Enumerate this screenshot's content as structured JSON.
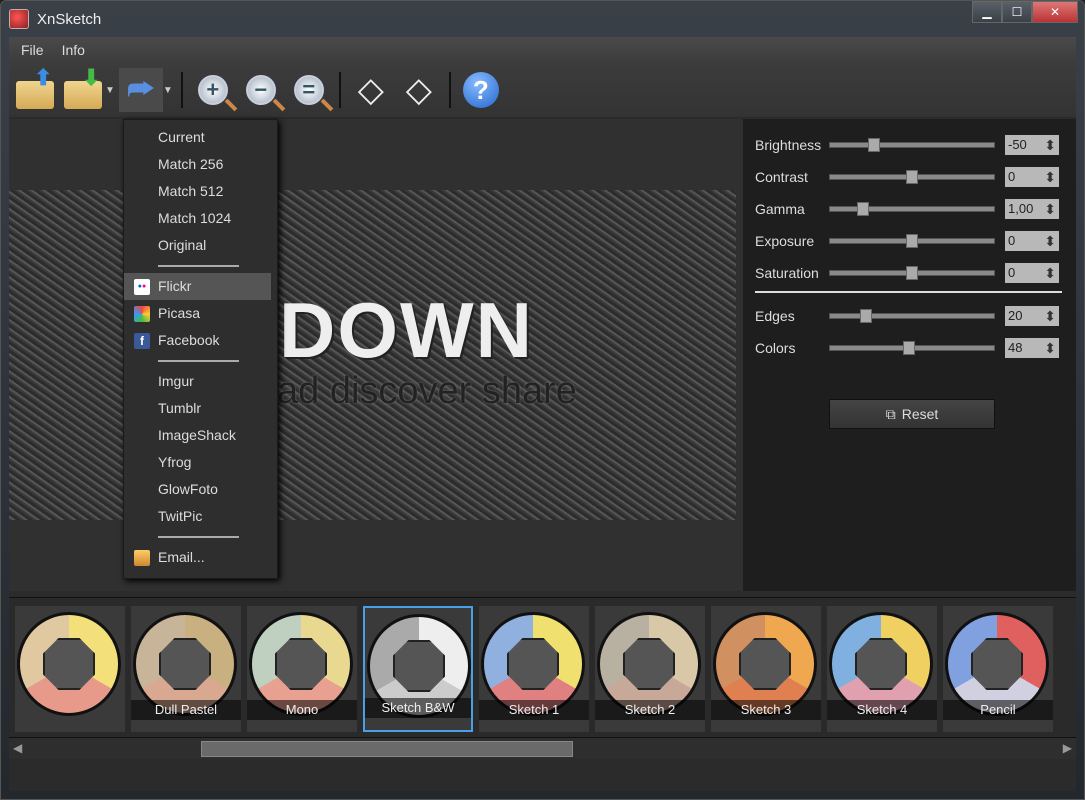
{
  "window": {
    "title": "XnSketch",
    "minimize": "▁",
    "maximize": "☐",
    "close": "✕"
  },
  "menubar": [
    "File",
    "Info"
  ],
  "toolbar": {
    "help": "?"
  },
  "preview": {
    "logo_text": "DOWN",
    "slogan": "ad discover share"
  },
  "export_menu": {
    "sizes": [
      {
        "label": "Current",
        "checked": false
      },
      {
        "label": "Match 256",
        "checked": false
      },
      {
        "label": "Match 512",
        "checked": true
      },
      {
        "label": "Match 1024",
        "checked": false
      },
      {
        "label": "Original",
        "checked": false
      }
    ],
    "check_glyph": "✔",
    "services": [
      {
        "label": "Flickr",
        "highlighted": true,
        "icon": "flickr-icon"
      },
      {
        "label": "Picasa",
        "icon": "picasa-icon"
      },
      {
        "label": "Facebook",
        "icon": "facebook-icon",
        "glyph": "f"
      }
    ],
    "others": [
      "Imgur",
      "Tumblr",
      "ImageShack",
      "Yfrog",
      "GlowFoto",
      "TwitPic"
    ],
    "email": "Email..."
  },
  "adjustments": [
    {
      "label": "Brightness",
      "value": "-50",
      "position": 0.27
    },
    {
      "label": "Contrast",
      "value": "0",
      "position": 0.5
    },
    {
      "label": "Gamma",
      "value": "1,00",
      "position": 0.2
    },
    {
      "label": "Exposure",
      "value": "0",
      "position": 0.5
    },
    {
      "label": "Saturation",
      "value": "0",
      "position": 0.5
    },
    {
      "label": "Edges",
      "value": "20",
      "position": 0.22
    },
    {
      "label": "Colors",
      "value": "48",
      "position": 0.48
    }
  ],
  "reset_label": "Reset",
  "presets": [
    {
      "label": "",
      "colors": [
        "#f4e07a",
        "#e89a8a",
        "#e0c8a0"
      ]
    },
    {
      "label": "Dull Pastel",
      "colors": [
        "#c8b080",
        "#d8a890",
        "#c8b498"
      ]
    },
    {
      "label": "Mono",
      "colors": [
        "#e8d890",
        "#e8a090",
        "#c0d0c0"
      ]
    },
    {
      "label": "Sketch B&W",
      "colors": [
        "#eeeeee",
        "#cccccc",
        "#aaaaaa"
      ],
      "selected": true
    },
    {
      "label": "Sketch 1",
      "colors": [
        "#f0e070",
        "#e08080",
        "#90b0e0"
      ]
    },
    {
      "label": "Sketch 2",
      "colors": [
        "#d8c8a8",
        "#c8a898",
        "#b8b0a0"
      ]
    },
    {
      "label": "Sketch 3",
      "colors": [
        "#f0a850",
        "#e08050",
        "#d09060"
      ]
    },
    {
      "label": "Sketch 4",
      "colors": [
        "#f0d060",
        "#e0a0b0",
        "#80b0e0"
      ]
    },
    {
      "label": "Pencil",
      "colors": [
        "#e06060",
        "#d0d0e0",
        "#80a0e0"
      ]
    }
  ],
  "scroll": {
    "left": "◀",
    "right": "▶"
  }
}
